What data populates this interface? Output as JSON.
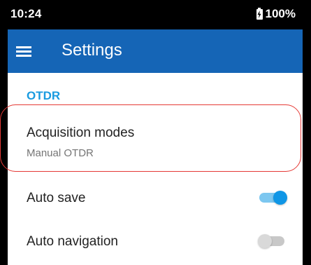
{
  "status_bar": {
    "time": "10:24",
    "battery": "100%",
    "battery_icon": "battery-charging-icon"
  },
  "app_bar": {
    "menu_icon": "hamburger-menu-icon",
    "title": "Settings",
    "color": "#1565b6"
  },
  "section": {
    "title": "OTDR",
    "color": "#1a9be0"
  },
  "preferences": {
    "acquisition": {
      "title": "Acquisition modes",
      "summary": "Manual OTDR",
      "highlighted": true
    },
    "auto_save": {
      "title": "Auto save",
      "enabled": true
    },
    "auto_navigation": {
      "title": "Auto navigation",
      "enabled": false
    }
  },
  "highlight_color": "#e53935"
}
